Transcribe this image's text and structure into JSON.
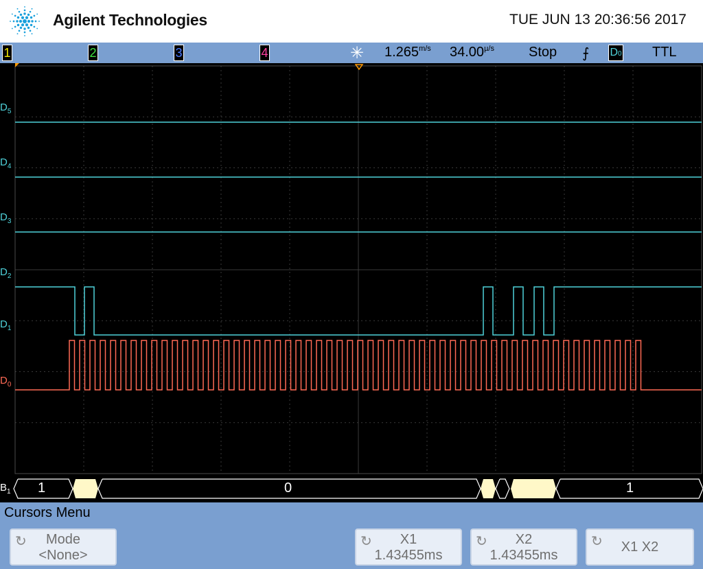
{
  "header": {
    "brand": "Agilent Technologies",
    "datetime": "TUE JUN 13 20:36:56 2017"
  },
  "statusbar": {
    "channels": [
      {
        "label": "1",
        "color": "#f2e600"
      },
      {
        "label": "2",
        "color": "#3fe03f"
      },
      {
        "label": "3",
        "color": "#4a7aff"
      },
      {
        "label": "4",
        "color": "#ff3fa0"
      }
    ],
    "run_icon": "acquisition-star-icon",
    "time_ref": "1.265",
    "time_ref_unit": "m/s",
    "timebase": "34.00",
    "timebase_unit": "µ/s",
    "run_state": "Stop",
    "trigger_icon": "falling-edge-icon",
    "trigger_source": "D",
    "trigger_source_sub": "0",
    "trigger_level": "TTL"
  },
  "scope": {
    "digital_labels": [
      {
        "main": "D",
        "sub": "5"
      },
      {
        "main": "D",
        "sub": "4"
      },
      {
        "main": "D",
        "sub": "3"
      },
      {
        "main": "D",
        "sub": "2"
      },
      {
        "main": "D",
        "sub": "1"
      },
      {
        "main": "D",
        "sub": "0"
      }
    ],
    "bus_label": "B",
    "bus_label_sub": "1",
    "bus_values": [
      "1",
      "0",
      "1"
    ],
    "colors": {
      "digital": "#4fd2da",
      "d0": "#ff6a55",
      "grid": "#3a3a3a",
      "bus_fill": "#fff8c8",
      "trigger_marker": "#ff9a00"
    }
  },
  "menu": {
    "title": "Cursors Menu",
    "softkeys": [
      {
        "line1": "Mode",
        "line2": "<None>"
      },
      {
        "line1": "X1",
        "line2": "1.43455ms"
      },
      {
        "line1": "X2",
        "line2": "1.43455ms"
      },
      {
        "line1": "X1 X2",
        "line2": ""
      }
    ]
  }
}
